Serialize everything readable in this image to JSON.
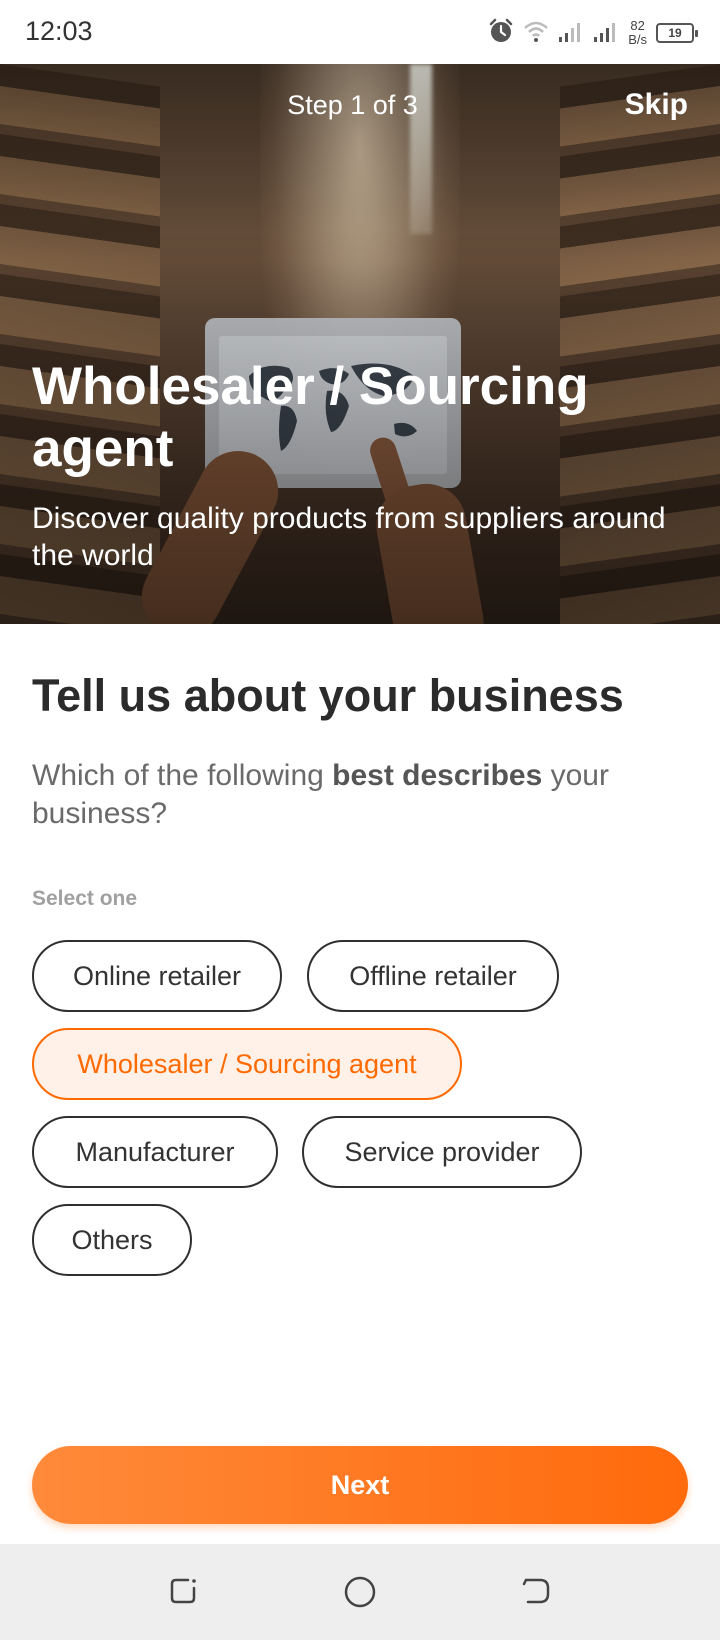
{
  "status_bar": {
    "time": "12:03",
    "net_speed_value": "82",
    "net_speed_unit": "B/s",
    "battery": "19",
    "icons": [
      "alarm-icon",
      "wifi-icon",
      "signal-icon",
      "signal-icon",
      "battery-icon"
    ]
  },
  "hero": {
    "step": "Step 1 of 3",
    "skip": "Skip",
    "title": "Wholesaler / Sourcing agent",
    "subtitle": "Discover quality products from suppliers around the world"
  },
  "form": {
    "title": "Tell us about your business",
    "question_prefix": "Which of the following ",
    "question_bold": "best describes",
    "question_suffix": " your business?",
    "hint": "Select one",
    "options": [
      {
        "label": "Online retailer",
        "selected": false
      },
      {
        "label": "Offline retailer",
        "selected": false
      },
      {
        "label": "Wholesaler / Sourcing agent",
        "selected": true
      },
      {
        "label": "Manufacturer",
        "selected": false
      },
      {
        "label": "Service provider",
        "selected": false
      },
      {
        "label": "Others",
        "selected": false
      }
    ]
  },
  "next_button": "Next",
  "colors": {
    "accent": "#ff6a00",
    "selected_bg": "#fff1e7",
    "nav_bg": "#eeeeee"
  }
}
